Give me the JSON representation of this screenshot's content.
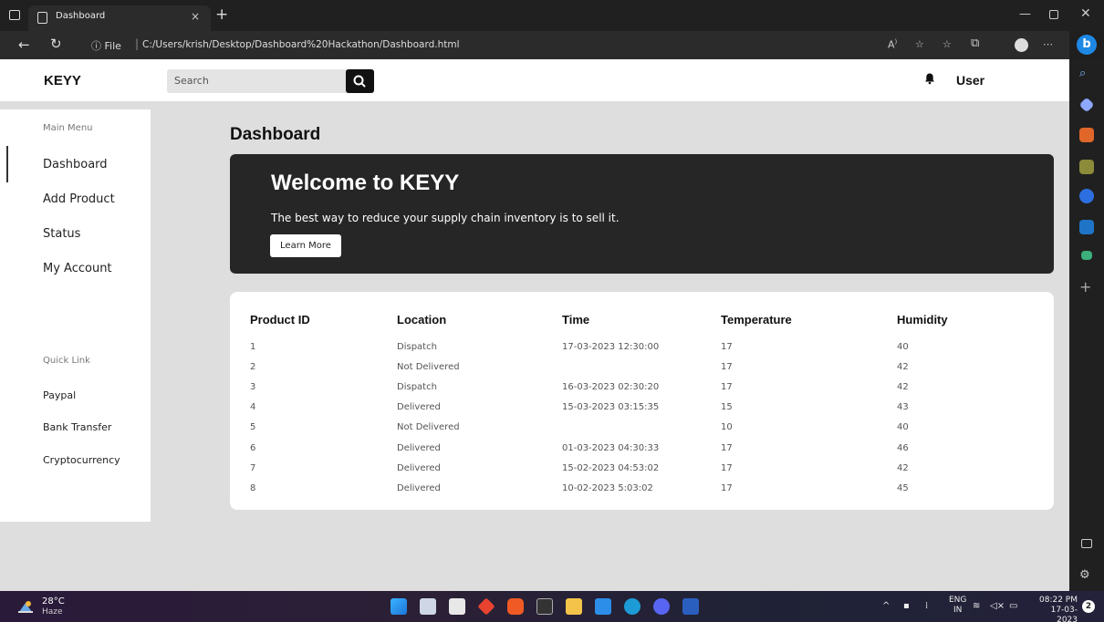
{
  "browser": {
    "tab_title": "Dashboard",
    "tab_close": "×",
    "new_tab": "+",
    "url_prefix": "ⓘ File",
    "url": "C:/Users/krish/Desktop/Dashboard%20Hackathon/Dashboard.html"
  },
  "header": {
    "logo": "KEYY",
    "search_placeholder": "Search",
    "user": "User"
  },
  "sidebar": {
    "main_heading": "Main Menu",
    "items": [
      "Dashboard",
      "Add Product",
      "Status",
      "My Account"
    ],
    "quick_heading": "Quick Link",
    "quick_links": [
      "Paypal",
      "Bank Transfer",
      "Cryptocurrency"
    ]
  },
  "main": {
    "title": "Dashboard",
    "banner": {
      "title": "Welcome to KEYY",
      "subtitle": "The best way to reduce your supply chain inventory is to sell it.",
      "button": "Learn More"
    },
    "table": {
      "headers": [
        "Product ID",
        "Location",
        "Time",
        "Temperature",
        "Humidity"
      ],
      "rows": [
        [
          "1",
          "Dispatch",
          "17-03-2023 12:30:00",
          "17",
          "40"
        ],
        [
          "2",
          "Not Delivered",
          "",
          "17",
          "42"
        ],
        [
          "3",
          "Dispatch",
          "16-03-2023 02:30:20",
          "17",
          "42"
        ],
        [
          "4",
          "Delivered",
          "15-03-2023 03:15:35",
          "15",
          "43"
        ],
        [
          "5",
          "Not Delivered",
          "",
          "10",
          "40"
        ],
        [
          "6",
          "Delivered",
          "01-03-2023 04:30:33",
          "17",
          "46"
        ],
        [
          "7",
          "Delivered",
          "15-02-2023 04:53:02",
          "17",
          "42"
        ],
        [
          "8",
          "Delivered",
          "10-02-2023 5:03:02",
          "17",
          "45"
        ]
      ]
    }
  },
  "taskbar": {
    "temp": "28°C",
    "condition": "Haze",
    "lang_1": "ENG",
    "lang_2": "IN",
    "time": "08:22 PM",
    "date": "17-03-2023",
    "notifications": "2"
  },
  "colors": {
    "page_bg": "#dedede",
    "banner_bg": "#262626",
    "card_bg": "#ffffff",
    "accent": "#111111"
  }
}
